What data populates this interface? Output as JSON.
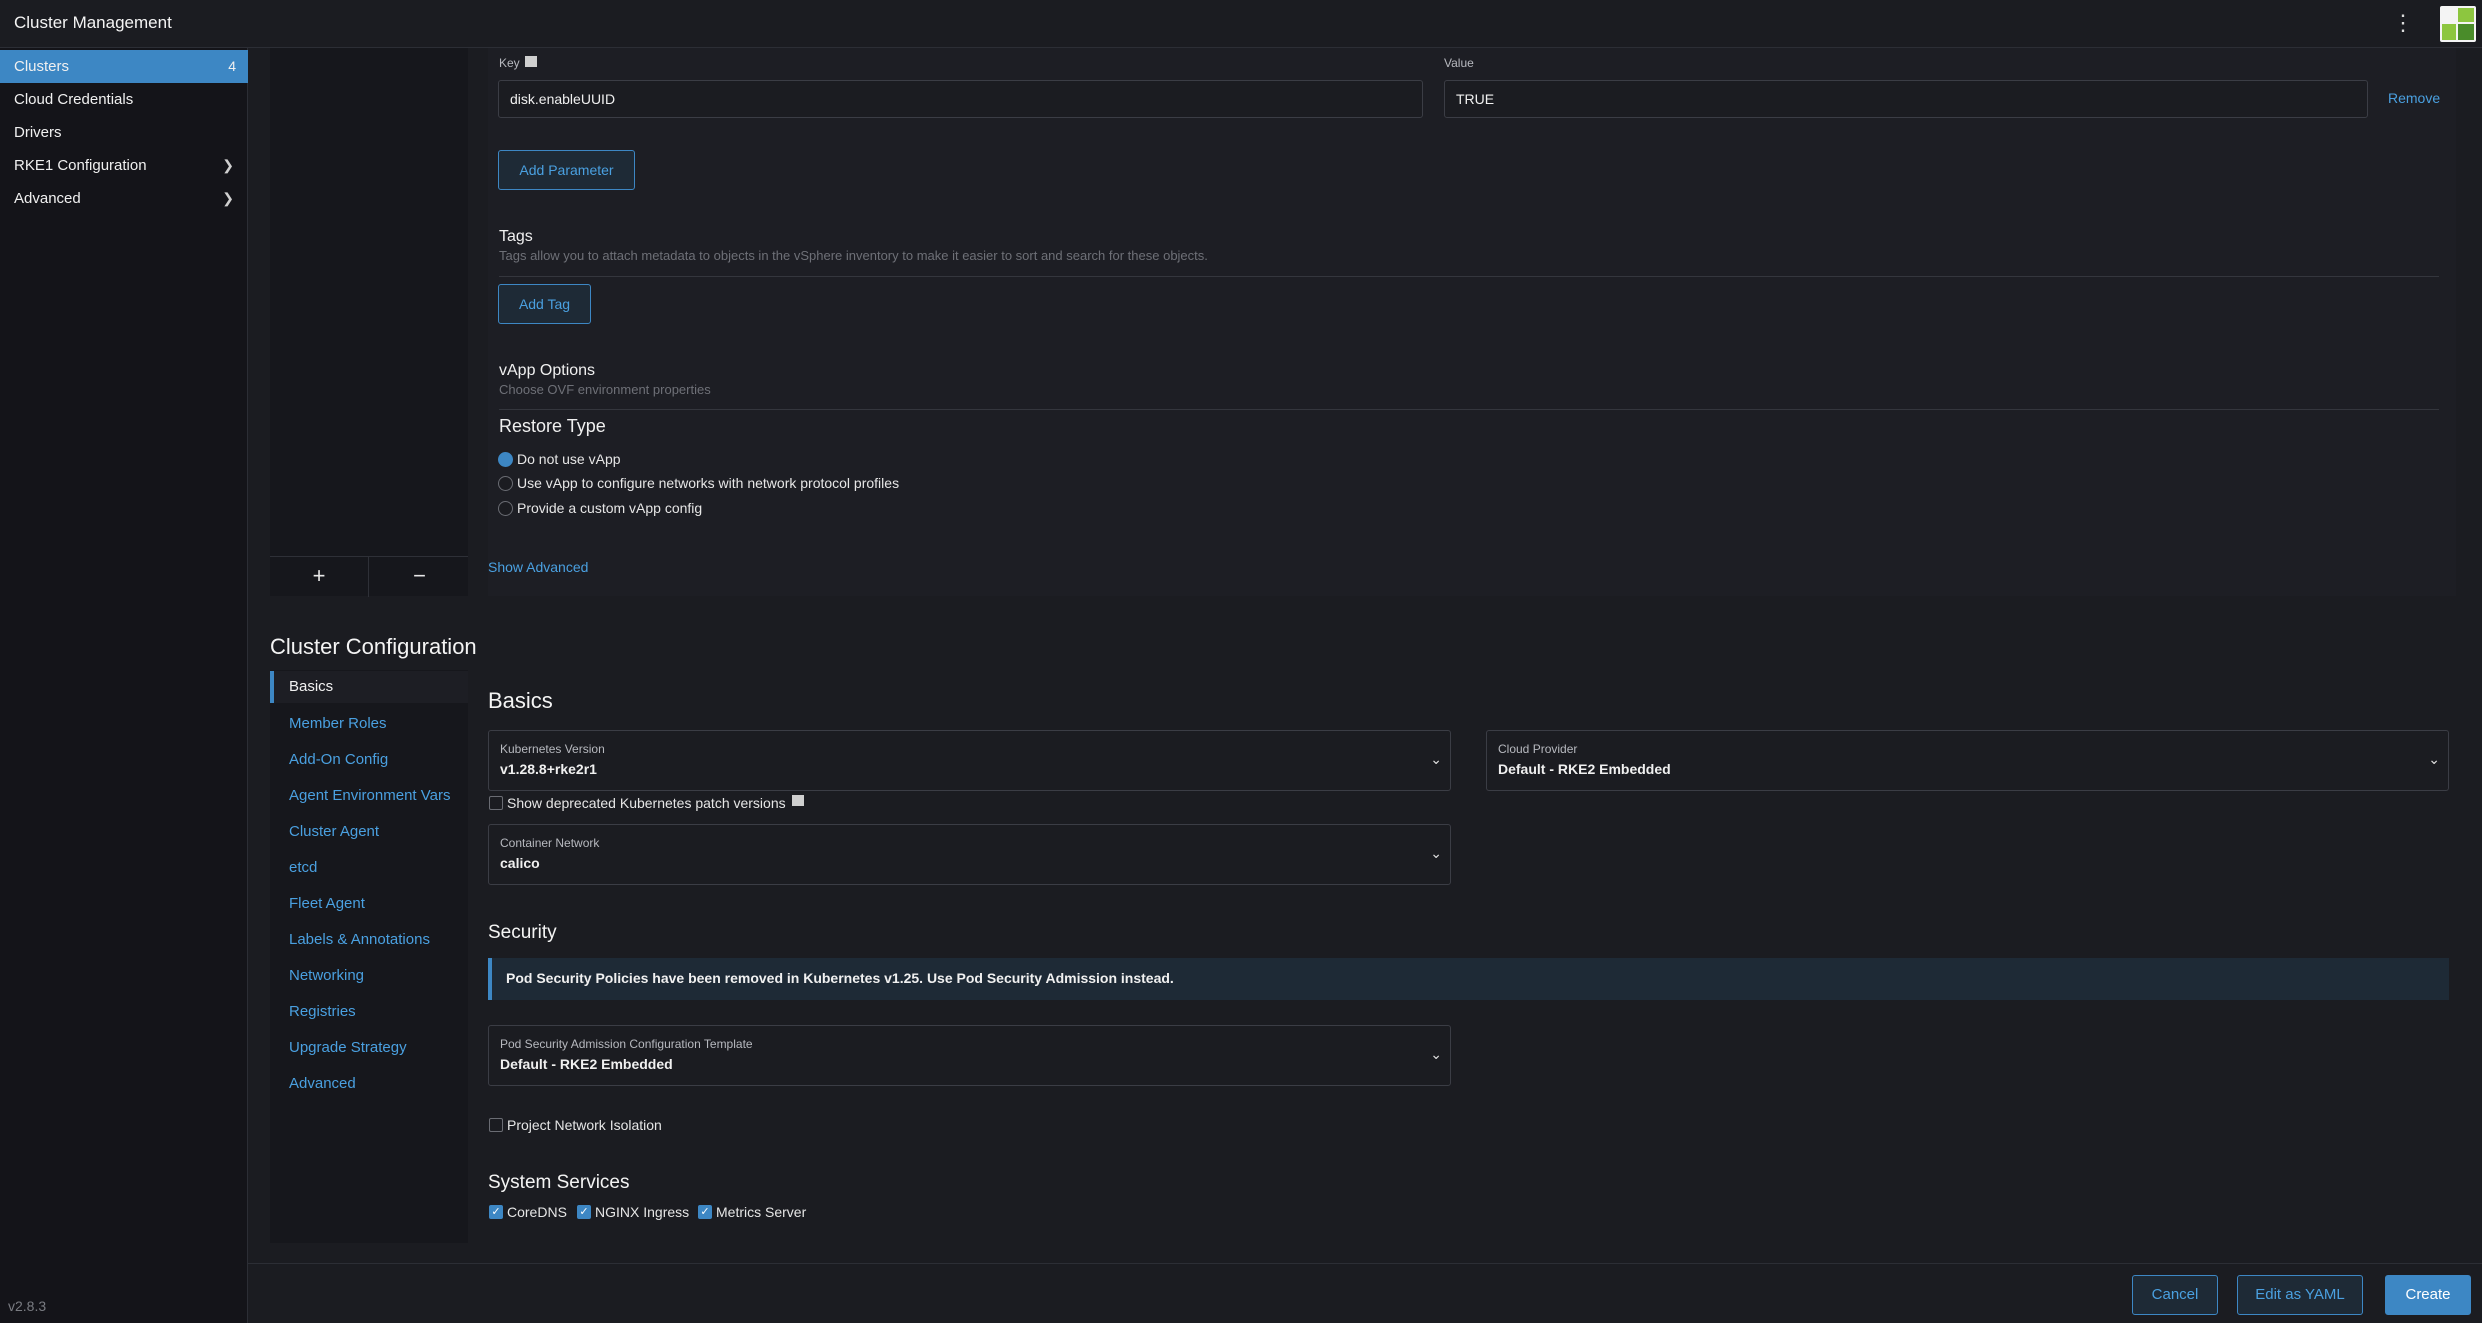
{
  "header": {
    "title": "Cluster Management",
    "menu_icon": "kebab-icon",
    "avatar_icon": "avatar-icon"
  },
  "sidebar": {
    "items": [
      {
        "label": "Clusters",
        "count": "4",
        "active": true
      },
      {
        "label": "Cloud Credentials"
      },
      {
        "label": "Drivers"
      },
      {
        "label": "RKE1 Configuration",
        "chevron": "chevron-right-icon"
      },
      {
        "label": "Advanced",
        "chevron": "chevron-right-icon"
      }
    ],
    "version": "v2.8.3"
  },
  "machine_pool": {
    "add_symbol": "+",
    "remove_symbol": "−",
    "params": {
      "key_label": "Key",
      "value_label": "Value",
      "key_value": "disk.enableUUID",
      "value_value": "TRUE",
      "remove_label": "Remove",
      "add_label": "Add Parameter"
    },
    "tags": {
      "title": "Tags",
      "description": "Tags allow you to attach metadata to objects in the vSphere inventory to make it easier to sort and search for these objects.",
      "add_label": "Add Tag"
    },
    "vapp": {
      "title": "vApp Options",
      "description": "Choose OVF environment properties",
      "restore_title": "Restore Type",
      "options": [
        {
          "label": "Do not use vApp",
          "selected": true
        },
        {
          "label": "Use vApp to configure networks with network protocol profiles",
          "selected": false
        },
        {
          "label": "Provide a custom vApp config",
          "selected": false
        }
      ]
    },
    "show_advanced": "Show Advanced"
  },
  "cluster_config": {
    "title": "Cluster Configuration",
    "tabs": [
      "Basics",
      "Member Roles",
      "Add-On Config",
      "Agent Environment Vars",
      "Cluster Agent",
      "etcd",
      "Fleet Agent",
      "Labels & Annotations",
      "Networking",
      "Registries",
      "Upgrade Strategy",
      "Advanced"
    ],
    "basics": {
      "title": "Basics",
      "k8s_version_label": "Kubernetes Version",
      "k8s_version_value": "v1.28.8+rke2r1",
      "cloud_provider_label": "Cloud Provider",
      "cloud_provider_value": "Default - RKE2 Embedded",
      "show_deprecated_label": "Show deprecated Kubernetes patch versions",
      "container_network_label": "Container Network",
      "container_network_value": "calico"
    },
    "security": {
      "title": "Security",
      "banner": "Pod Security Policies have been removed in Kubernetes v1.25. Use Pod Security Admission instead.",
      "psa_label": "Pod Security Admission Configuration Template",
      "psa_value": "Default - RKE2 Embedded",
      "network_isolation_label": "Project Network Isolation"
    },
    "system_services": {
      "title": "System Services",
      "items": [
        "CoreDNS",
        "NGINX Ingress",
        "Metrics Server"
      ]
    }
  },
  "footer": {
    "cancel": "Cancel",
    "edit_yaml": "Edit as YAML",
    "create": "Create"
  },
  "colors": {
    "accent": "#3d87c4",
    "link": "#4aa0e0",
    "background": "#1b1c21",
    "logo_green": "#8dc63f"
  }
}
